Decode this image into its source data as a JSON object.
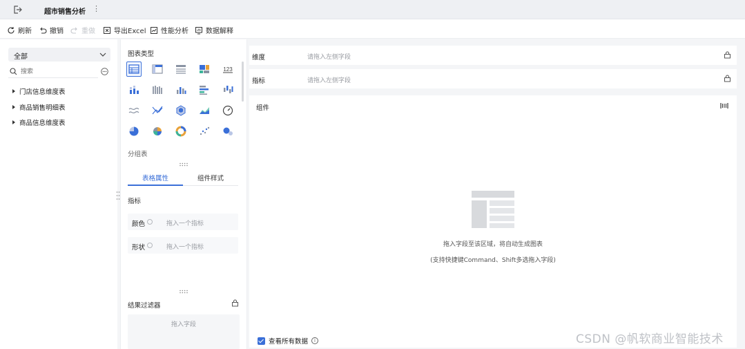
{
  "titlebar": {
    "title": "超市销售分析",
    "more": "⋮",
    "back_icon": "exit-icon"
  },
  "toolbar": {
    "refresh": "刷新",
    "undo": "撤销",
    "redo": "重做",
    "export_excel": "导出Excel",
    "perf": "性能分析",
    "explain": "数据解释"
  },
  "left": {
    "select_value": "全部",
    "search_placeholder": "搜索",
    "tree": [
      "门店信息维度表",
      "商品销售明细表",
      "商品信息维度表"
    ]
  },
  "middle": {
    "chart_type_title": "图表类型",
    "group_label": "分组表",
    "tabs": [
      "表格属性",
      "组件样式"
    ],
    "metric_title": "指标",
    "fields": [
      {
        "label": "颜色",
        "placeholder": "拖入一个指标"
      },
      {
        "label": "形状",
        "placeholder": "拖入一个指标"
      }
    ],
    "filter_title": "结果过滤器",
    "filter_placeholder": "拖入字段",
    "chart_icons": [
      "grouped-table-icon",
      "crosstab-icon",
      "detail-table-icon",
      "treemap-icon",
      "kpi-number-icon",
      "stacked-bar-icon",
      "multi-bar-icon",
      "column-icon",
      "horizontal-bar-icon",
      "range-column-icon",
      "line-icon",
      "cross-line-icon",
      "hexagon-map-icon",
      "area-icon",
      "gauge-icon",
      "pie-icon",
      "multi-pie-icon",
      "donut-icon",
      "scatter-icon",
      "bubble-icon"
    ]
  },
  "right": {
    "dimension_label": "维度",
    "dimension_placeholder": "请拖入左侧字段",
    "metric_label": "指标",
    "metric_placeholder": "请拖入左侧字段",
    "component_label": "组件",
    "empty_line1": "拖入字段至该区域，将自动生成图表",
    "empty_line2": "(支持快捷键Command、Shift多选拖入字段)",
    "view_all": "查看所有数据"
  },
  "watermark": "CSDN @帆软商业智能技术",
  "accent": "#3a6fd8"
}
